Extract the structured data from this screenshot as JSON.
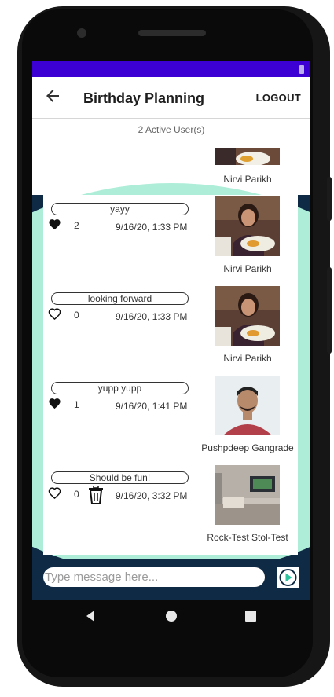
{
  "app": {
    "title": "Birthday Planning",
    "logout_label": "LOGOUT",
    "active_users": "2 Active User(s)"
  },
  "colors": {
    "status_bar": "#3d00d4",
    "navy": "#0f2a44",
    "mint": "#aeeed8"
  },
  "top_partial_user": {
    "name": "Nirvi Parikh"
  },
  "messages": [
    {
      "text": "yayy",
      "liked": true,
      "likes": "2",
      "time": "9/16/20, 1:33 PM",
      "user": "Nirvi Parikh",
      "avatar": "photo-girl-restaurant",
      "deletable": false
    },
    {
      "text": "looking forward",
      "liked": false,
      "likes": "0",
      "time": "9/16/20, 1:33 PM",
      "user": "Nirvi Parikh",
      "avatar": "photo-girl-restaurant",
      "deletable": false
    },
    {
      "text": "yupp yupp",
      "liked": true,
      "likes": "1",
      "time": "9/16/20, 1:41 PM",
      "user": "Pushpdeep Gangrade",
      "avatar": "photo-man-red-shirt",
      "deletable": false
    },
    {
      "text": "Should be fun!",
      "liked": false,
      "likes": "0",
      "time": "9/16/20, 3:32 PM",
      "user": "Rock-Test Stol-Test",
      "avatar": "photo-room-tv",
      "deletable": true
    }
  ],
  "composer": {
    "placeholder": "Type message here...",
    "send_icon": "play-arrow-icon"
  },
  "navbar": {
    "back_icon": "triangle-back-icon",
    "home_icon": "circle-home-icon",
    "recents_icon": "square-recents-icon"
  }
}
